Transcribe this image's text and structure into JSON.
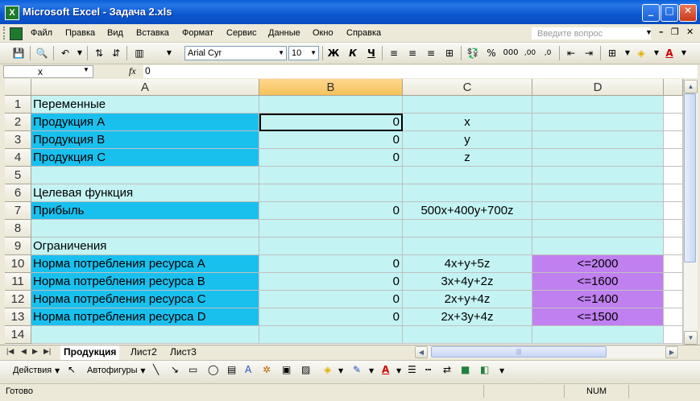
{
  "window": {
    "title": "Microsoft Excel - Задача 2.xls",
    "app_icon_letter": "X"
  },
  "menu": {
    "items": [
      "Файл",
      "Правка",
      "Вид",
      "Вставка",
      "Формат",
      "Сервис",
      "Данные",
      "Окно",
      "Справка"
    ],
    "help_placeholder": "Введите вопрос"
  },
  "toolbar": {
    "font_name": "Arial Cyr",
    "font_size": "10",
    "bold": "Ж",
    "italic": "К",
    "underline": "Ч",
    "percent": "%",
    "thousands": "000",
    "inc_decimals": ",00",
    "dec_decimals": ",0"
  },
  "formula_bar": {
    "name_box": "x",
    "fx": "fx",
    "formula": "0"
  },
  "columns": [
    "A",
    "B",
    "C",
    "D"
  ],
  "rows": [
    {
      "num": "1",
      "a": "Переменные",
      "b": "",
      "c": "",
      "d": ""
    },
    {
      "num": "2",
      "a": "Продукция A",
      "b": "0",
      "c": "x",
      "d": ""
    },
    {
      "num": "3",
      "a": "Продукция B",
      "b": "0",
      "c": "y",
      "d": ""
    },
    {
      "num": "4",
      "a": "Продукция C",
      "b": "0",
      "c": "z",
      "d": ""
    },
    {
      "num": "5",
      "a": "",
      "b": "",
      "c": "",
      "d": ""
    },
    {
      "num": "6",
      "a": "Целевая функция",
      "b": "",
      "c": "",
      "d": ""
    },
    {
      "num": "7",
      "a": "Прибыль",
      "b": "0",
      "c": "500x+400y+700z",
      "d": ""
    },
    {
      "num": "8",
      "a": "",
      "b": "",
      "c": "",
      "d": ""
    },
    {
      "num": "9",
      "a": "Ограничения",
      "b": "",
      "c": "",
      "d": ""
    },
    {
      "num": "10",
      "a": "Норма потребления ресурса A",
      "b": "0",
      "c": "4x+y+5z",
      "d": "<=2000"
    },
    {
      "num": "11",
      "a": "Норма потребления ресурса B",
      "b": "0",
      "c": "3x+4y+2z",
      "d": "<=1600"
    },
    {
      "num": "12",
      "a": "Норма потребления ресурса C",
      "b": "0",
      "c": "2x+y+4z",
      "d": "<=1400"
    },
    {
      "num": "13",
      "a": "Норма потребления ресурса D",
      "b": "0",
      "c": "2x+3y+4z",
      "d": "<=1500"
    },
    {
      "num": "14",
      "a": "",
      "b": "",
      "c": "",
      "d": ""
    }
  ],
  "sheet_tabs": [
    "Продукция",
    "Лист2",
    "Лист3"
  ],
  "drawing_toolbar": {
    "actions": "Действия",
    "autoshapes": "Автофигуры"
  },
  "status": {
    "ready": "Готово",
    "num": "NUM"
  },
  "colors": {
    "light_cyan": "#c4f3f3",
    "blue_cyan": "#19c0ee",
    "violet": "#c080f0",
    "title_blue": "#0a5fd8"
  }
}
